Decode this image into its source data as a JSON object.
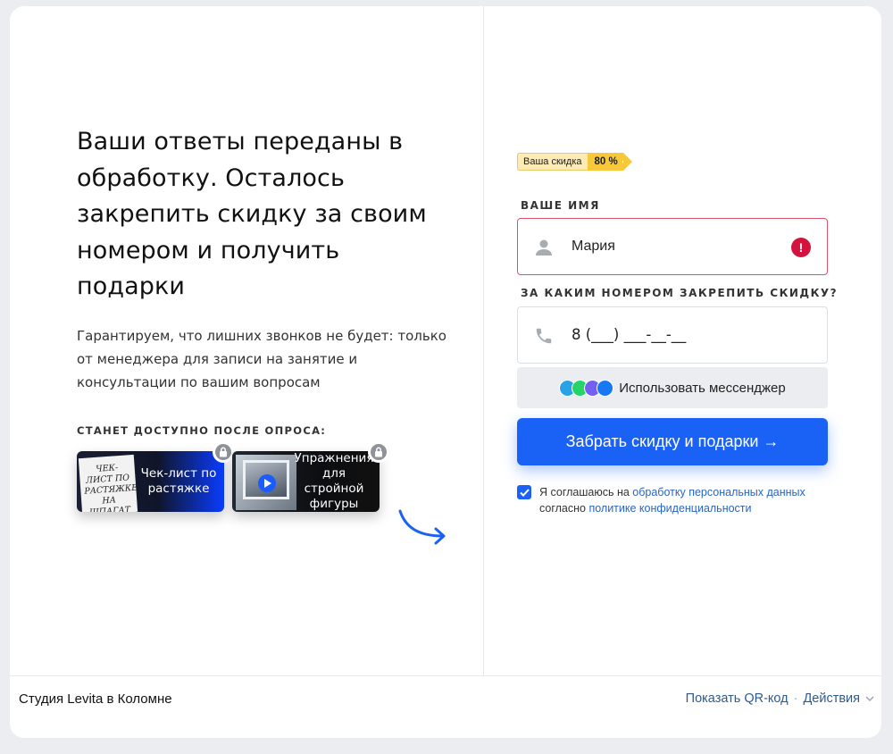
{
  "left": {
    "headline": "Ваши ответы переданы в обработку. Осталось закрепить скидку за своим номером и получить подарки",
    "subtitle": "Гарантируем, что лишних звонков не будет: только от менеджера для записи на занятие и консультации по вашим вопросам",
    "after_label": "СТАНЕТ ДОСТУПНО ПОСЛЕ ОПРОСА:",
    "gifts": [
      {
        "title": "Чек-лист по растяжке",
        "thumb_text": "ЧЕК-ЛИСТ ПО РАСТЯЖКЕ НА ШПАГАТ",
        "icon": "lock-icon"
      },
      {
        "title": "Упражнения для стройной фигуры",
        "icon": "lock-icon"
      }
    ]
  },
  "right": {
    "discount": {
      "label": "Ваша скидка",
      "value": "80 %"
    },
    "name_label": "ВАШЕ ИМЯ",
    "name_value": "Мария",
    "phone_label": "ЗА КАКИМ НОМЕРОМ ЗАКРЕПИТЬ СКИДКУ?",
    "phone_value": "8 (___) ___-__-__",
    "messenger_button": "Использовать мессенджер",
    "submit_button": "Забрать скидку и подарки →",
    "consent": {
      "text_1": "Я соглашаюсь на ",
      "link_1": "обработку персональных данных",
      "text_2": " согласно ",
      "link_2": "политике конфиденциальности"
    }
  },
  "footer": {
    "studio": "Студия Levita в Коломне",
    "qr_link": "Показать QR-код",
    "separator": "·",
    "actions": "Действия"
  },
  "colors": {
    "primary": "#1a62f5",
    "error": "#d4123e",
    "badge": "#f7c93a",
    "link": "#2a64c6"
  }
}
